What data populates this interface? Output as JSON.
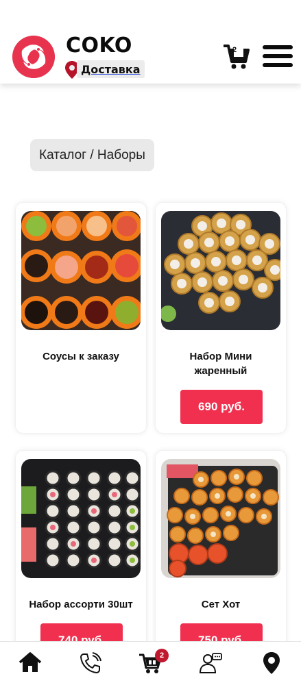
{
  "header": {
    "brand": "COKO",
    "delivery_label": "Доставка",
    "cart_count": "2"
  },
  "breadcrumb": "Каталог / Наборы",
  "products": [
    {
      "title": "Соусы к заказу",
      "price": "",
      "image": "sauces-image"
    },
    {
      "title": "Набор Мини жаренный",
      "price": "690 руб.",
      "image": "fried-rolls-image"
    },
    {
      "title": "Набор ассорти 30шт",
      "price": "740 руб.",
      "image": "assorted-rolls-image"
    },
    {
      "title": "Сет Хот",
      "price": "750 руб.",
      "image": "hot-set-image"
    }
  ],
  "bottom_nav": {
    "cart_badge": "2",
    "items": [
      "home-icon",
      "phone-icon",
      "cart-icon",
      "support-icon",
      "location-icon"
    ]
  },
  "colors": {
    "accent": "#f0304e",
    "logo": "#e8334f",
    "badge": "#c0182f"
  }
}
